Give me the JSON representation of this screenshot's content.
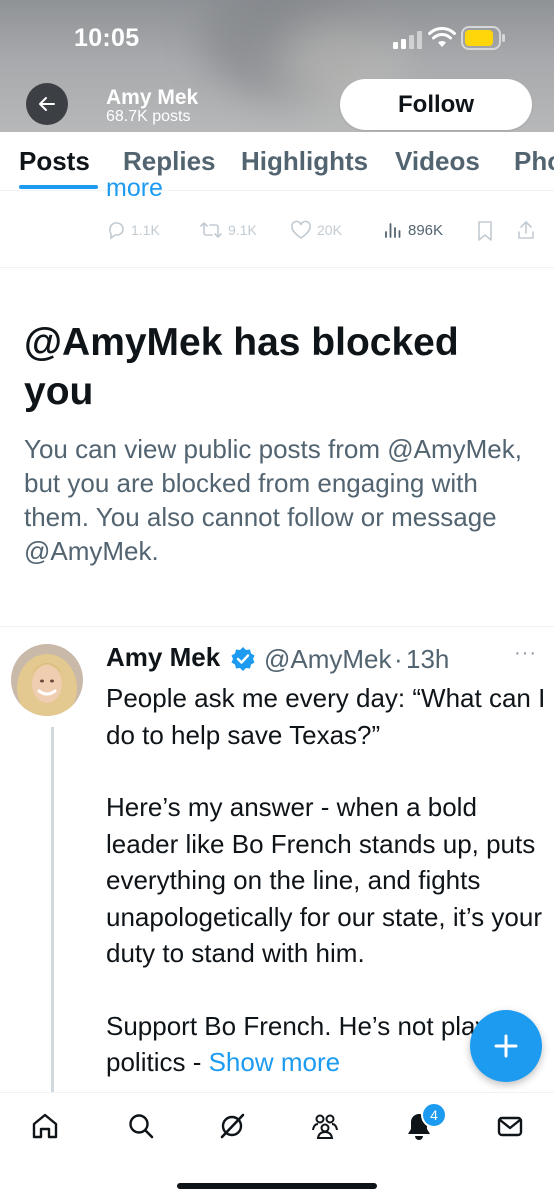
{
  "status_bar": {
    "time": "10:05"
  },
  "header": {
    "name": "Amy Mek",
    "post_count": "68.7K posts",
    "follow_label": "Follow"
  },
  "tabs": [
    {
      "label": "Posts",
      "active": true
    },
    {
      "label": "Replies"
    },
    {
      "label": "Highlights"
    },
    {
      "label": "Videos"
    },
    {
      "label": "Pho"
    }
  ],
  "prev_post": {
    "more_text": "more",
    "replies": "1.1K",
    "reposts": "9.1K",
    "likes": "20K",
    "views": "896K"
  },
  "blocked": {
    "title": "@AmyMek has blocked you",
    "description": "You can view public posts from @AmyMek, but you are blocked from engaging with them. You also cannot follow or message @AmyMek."
  },
  "tweet": {
    "name": "Amy Mek",
    "handle": "@AmyMek",
    "dot": "·",
    "time": "13h",
    "menu": "···",
    "paragraphs": [
      "People ask me every day: “What can I do to help save Texas?”",
      "Here’s my answer - when a bold leader like Bo French stands up, puts everything on the line, and fights unapologetically for our state, it’s your duty to stand with him."
    ],
    "last_paragraph": "Support Bo French. He’s not playing politics -",
    "show_more": "Show more"
  },
  "nav": {
    "notifications_badge": "4"
  },
  "colors": {
    "accent": "#1d9bf0",
    "text": "#0f1419",
    "secondary": "#536471"
  }
}
